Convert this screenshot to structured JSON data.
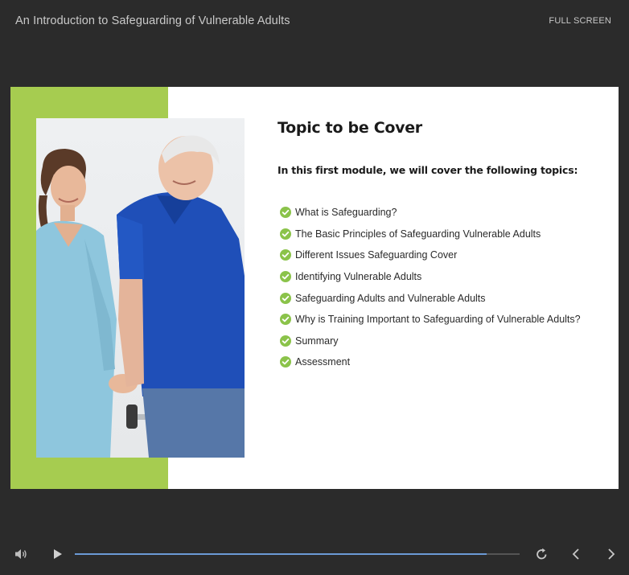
{
  "header": {
    "course_title": "An Introduction to Safeguarding of Vulnerable Adults",
    "fullscreen_label": "FULL SCREEN"
  },
  "slide": {
    "heading": "Topic to be Cover",
    "subheading": "In this first module, we will cover the following topics:",
    "topics": [
      "What is Safeguarding?",
      "The Basic Principles of Safeguarding Vulnerable Adults",
      "Different Issues Safeguarding Cover",
      "Identifying Vulnerable Adults",
      "Safeguarding Adults and Vulnerable Adults",
      "Why is Training Important to Safeguarding of Vulnerable Adults?",
      "Summary",
      "Assessment"
    ],
    "photo_icon": "nurse-helping-elderly-man-photo"
  },
  "controls": {
    "progress_fraction": 0.925,
    "icons": {
      "volume": "volume-icon",
      "play": "play-icon",
      "replay": "replay-icon",
      "previous": "chevron-left-icon",
      "next": "chevron-right-icon"
    }
  },
  "colors": {
    "background": "#2b2b2b",
    "accent_green": "#a6cc50",
    "check_green": "#8bc34a",
    "progress_blue": "#6b9ad6"
  }
}
